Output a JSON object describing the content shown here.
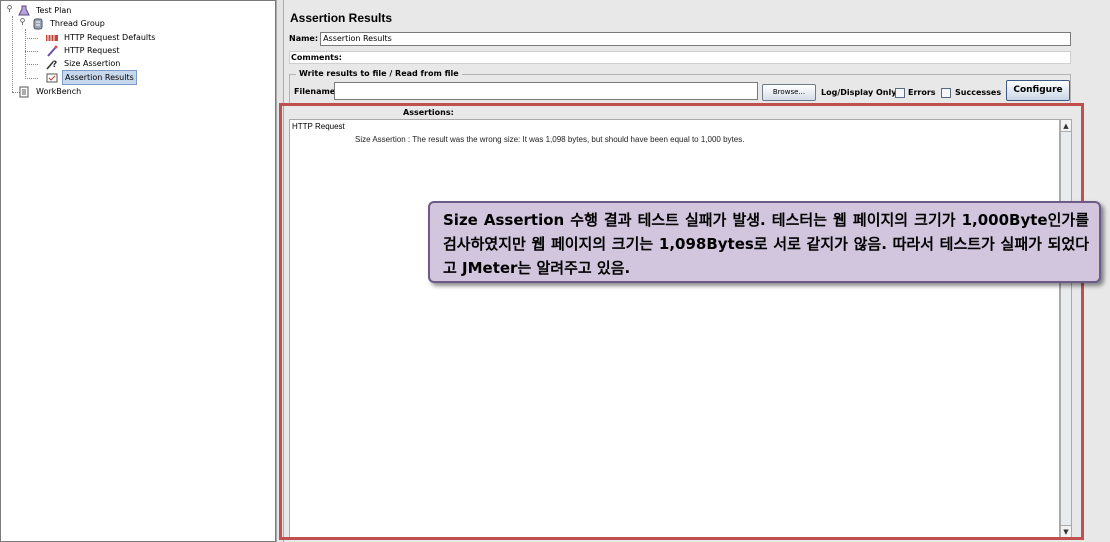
{
  "tree": {
    "items": [
      {
        "label": "Test Plan",
        "icon": "test-plan-icon"
      },
      {
        "label": "Thread Group",
        "icon": "thread-group-icon"
      },
      {
        "label": "HTTP Request Defaults",
        "icon": "config-element-icon"
      },
      {
        "label": "HTTP Request",
        "icon": "sampler-icon"
      },
      {
        "label": "Size Assertion",
        "icon": "assertion-icon"
      },
      {
        "label": "Assertion Results",
        "icon": "listener-icon"
      },
      {
        "label": "WorkBench",
        "icon": "workbench-icon"
      }
    ],
    "selected": "Assertion Results"
  },
  "panel": {
    "title": "Assertion Results",
    "name_label": "Name:",
    "name_value": "Assertion Results",
    "comments_label": "Comments:",
    "file_group_label": "Write results to file / Read from file",
    "filename_label": "Filename",
    "filename_value": "",
    "browse_label": "Browse...",
    "log_display_label": "Log/Display Only:",
    "errors_label": "Errors",
    "errors_checked": false,
    "successes_label": "Successes",
    "successes_checked": false,
    "configure_label": "Configure",
    "assertions_label": "Assertions:"
  },
  "results": {
    "sampler": "HTTP Request",
    "message": "Size Assertion : The result was the wrong size: It was 1,098 bytes, but should have been equal to 1,000 bytes."
  },
  "callout": {
    "text": "Size Assertion 수행 결과 테스트 실패가 발생. 테스터는 웹 페이지의 크기가 1,000Byte인가를 검사하였지만 웹 페이지의 크기는 1,098Bytes로 서로 같지가 않음. 따라서 테스트가 실패가 되었다고 JMeter는 알려주고 있음."
  },
  "colors": {
    "highlight": "#c0504d",
    "callout_fill": "#d2c5de",
    "callout_border": "#6b5b86"
  }
}
